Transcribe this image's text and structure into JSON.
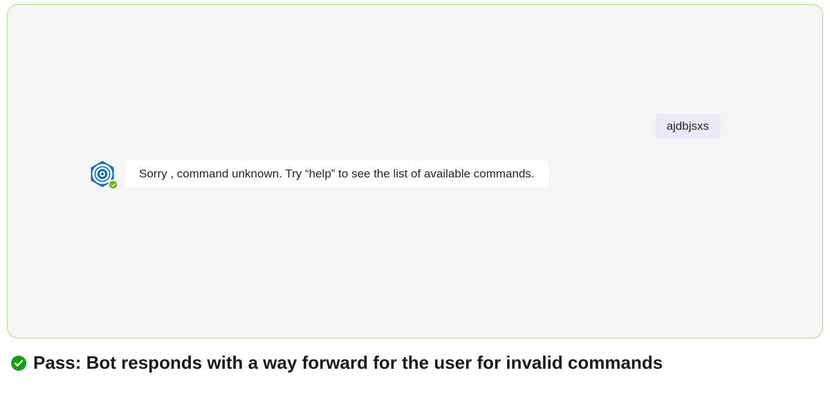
{
  "chat": {
    "user_message": "ajdbjsxs",
    "bot_message": "Sorry , command unknown. Try “help” to see the list of available commands."
  },
  "caption": {
    "text": "Pass: Bot responds with a way forward for the user for invalid commands"
  },
  "colors": {
    "panel_bg": "#f5f5f5",
    "panel_border": "#a7e082",
    "user_bubble_bg": "#e9eaf6",
    "bot_bubble_bg": "#ffffff",
    "avatar_primary": "#0f6cbd",
    "presence_green": "#6bb700",
    "pass_icon_green": "#13a10e"
  }
}
